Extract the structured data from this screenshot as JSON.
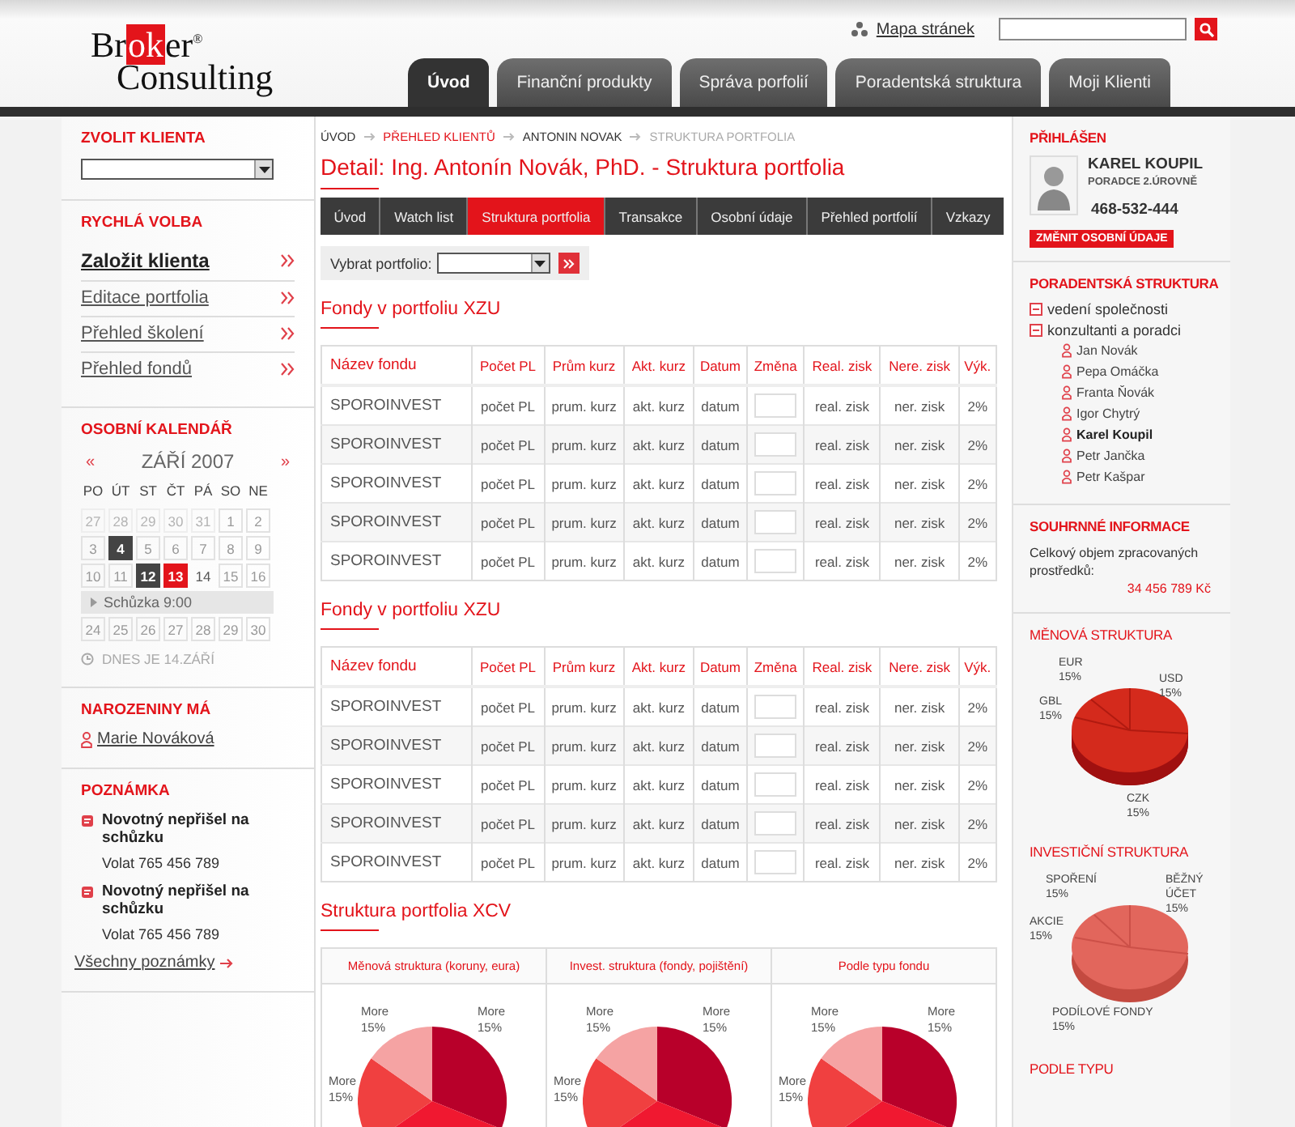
{
  "header": {
    "logo": {
      "parts": [
        "Br",
        "ok",
        "er"
      ],
      "mark": "®",
      "line2": "Consulting"
    },
    "sitemap_link": "Mapa stránek",
    "nav": [
      {
        "label": "Úvod",
        "selected": true
      },
      {
        "label": "Finanční produkty",
        "selected": false
      },
      {
        "label": "Správa porfolií",
        "selected": false
      },
      {
        "label": "Poradentská struktura",
        "selected": false
      },
      {
        "label": "Moji Klienti",
        "selected": false
      }
    ]
  },
  "left": {
    "client": {
      "title": "ZVOLIT KLIENTA"
    },
    "quick": {
      "title": "RYCHLÁ VOLBA",
      "items": [
        {
          "label": "Založit klienta",
          "selected": true
        },
        {
          "label": "Editace portfolia",
          "selected": false
        },
        {
          "label": "Přehled školení",
          "selected": false
        },
        {
          "label": "Přehled fondů",
          "selected": false
        }
      ]
    },
    "calendar": {
      "title": "OSOBNÍ KALENDÁŘ",
      "prev": "«",
      "month": "ZÁŘÍ 2007",
      "next": "»",
      "weekdays": [
        "PO",
        "ÚT",
        "ST",
        "ČT",
        "PÁ",
        "SO",
        "NE"
      ],
      "rows": [
        {
          "kind": "week",
          "days": [
            {
              "day": "27",
              "kind": "other"
            },
            {
              "day": "28",
              "kind": "other"
            },
            {
              "day": "29",
              "kind": "other"
            },
            {
              "day": "30",
              "kind": "other"
            },
            {
              "day": "31",
              "kind": "other"
            },
            {
              "day": "1",
              "kind": "normal"
            },
            {
              "day": "2",
              "kind": "normal"
            }
          ]
        },
        {
          "kind": "week",
          "days": [
            {
              "day": "3",
              "kind": "normal"
            },
            {
              "day": "4",
              "kind": "marked"
            },
            {
              "day": "5",
              "kind": "normal"
            },
            {
              "day": "6",
              "kind": "normal"
            },
            {
              "day": "7",
              "kind": "normal"
            },
            {
              "day": "8",
              "kind": "normal"
            },
            {
              "day": "9",
              "kind": "normal"
            }
          ]
        },
        {
          "kind": "week",
          "days": [
            {
              "day": "10",
              "kind": "normal"
            },
            {
              "day": "11",
              "kind": "normal"
            },
            {
              "day": "12",
              "kind": "marked"
            },
            {
              "day": "13",
              "kind": "today"
            },
            {
              "day": "14",
              "kind": "plain"
            },
            {
              "day": "15",
              "kind": "normal"
            },
            {
              "day": "16",
              "kind": "normal"
            }
          ]
        },
        {
          "kind": "event",
          "text": "Schůzka 9:00"
        },
        {
          "kind": "week",
          "days": [
            {
              "day": "24",
              "kind": "normal"
            },
            {
              "day": "25",
              "kind": "normal"
            },
            {
              "day": "26",
              "kind": "normal"
            },
            {
              "day": "27",
              "kind": "normal"
            },
            {
              "day": "28",
              "kind": "normal"
            },
            {
              "day": "29",
              "kind": "normal"
            },
            {
              "day": "30",
              "kind": "normal"
            }
          ]
        }
      ],
      "today_note": "DNES JE 14.ZÁŘÍ"
    },
    "birthday": {
      "title": "NAROZENINY MÁ",
      "person": "Marie Nováková"
    },
    "notes": {
      "title": "POZNÁMKA",
      "items": [
        {
          "title": "Novotný nepřišel na schůzku",
          "text": "Volat 765 456 789"
        },
        {
          "title": "Novotný nepřišel na schůzku",
          "text": "Volat 765 456 789"
        }
      ],
      "all_link": "Všechny poznámky"
    }
  },
  "main": {
    "breadcrumb": [
      {
        "label": "ÚVOD",
        "kind": "link"
      },
      {
        "label": "PŘEHLED KLIENTŮ",
        "kind": "hover"
      },
      {
        "label": "ANTONIN NOVAK",
        "kind": "link"
      },
      {
        "label": "STRUKTURA PORTFOLIA",
        "kind": "current"
      }
    ],
    "title": "Detail: Ing. Antonín Novák, PhD. - Struktura portfolia",
    "tabs": [
      {
        "label": "Úvod",
        "selected": false
      },
      {
        "label": "Watch list",
        "selected": false
      },
      {
        "label": "Struktura portfolia",
        "selected": true
      },
      {
        "label": "Transakce",
        "selected": false
      },
      {
        "label": "Osobní údaje",
        "selected": false
      },
      {
        "label": "Přehled portfolií",
        "selected": false
      },
      {
        "label": "Vzkazy",
        "selected": false
      }
    ],
    "portfolio_select": {
      "label": "Vybrat portfolio:"
    },
    "tables": [
      {
        "title": "Fondy v portfoliu XZU",
        "columns": [
          "Název fondu",
          "Počet PL",
          "Prům kurz",
          "Akt. kurz",
          "Datum",
          "Změna",
          "Real. zisk",
          "Nere. zisk",
          "Výk."
        ],
        "rows": [
          [
            "SPOROINVEST",
            "počet PL",
            "prum. kurz",
            "akt. kurz",
            "datum",
            "",
            "real. zisk",
            "ner. zisk",
            "2%"
          ],
          [
            "SPOROINVEST",
            "počet PL",
            "prum. kurz",
            "akt. kurz",
            "datum",
            "",
            "real. zisk",
            "ner. zisk",
            "2%"
          ],
          [
            "SPOROINVEST",
            "počet PL",
            "prum. kurz",
            "akt. kurz",
            "datum",
            "",
            "real. zisk",
            "ner. zisk",
            "2%"
          ],
          [
            "SPOROINVEST",
            "počet PL",
            "prum. kurz",
            "akt. kurz",
            "datum",
            "",
            "real. zisk",
            "ner. zisk",
            "2%"
          ],
          [
            "SPOROINVEST",
            "počet PL",
            "prum. kurz",
            "akt. kurz",
            "datum",
            "",
            "real. zisk",
            "ner. zisk",
            "2%"
          ]
        ]
      },
      {
        "title": "Fondy v portfoliu XZU",
        "columns": [
          "Název fondu",
          "Počet PL",
          "Prům kurz",
          "Akt. kurz",
          "Datum",
          "Změna",
          "Real. zisk",
          "Nere. zisk",
          "Výk."
        ],
        "rows": [
          [
            "SPOROINVEST",
            "počet PL",
            "prum. kurz",
            "akt. kurz",
            "datum",
            "",
            "real. zisk",
            "ner. zisk",
            "2%"
          ],
          [
            "SPOROINVEST",
            "počet PL",
            "prum. kurz",
            "akt. kurz",
            "datum",
            "",
            "real. zisk",
            "ner. zisk",
            "2%"
          ],
          [
            "SPOROINVEST",
            "počet PL",
            "prum. kurz",
            "akt. kurz",
            "datum",
            "",
            "real. zisk",
            "ner. zisk",
            "2%"
          ],
          [
            "SPOROINVEST",
            "počet PL",
            "prum. kurz",
            "akt. kurz",
            "datum",
            "",
            "real. zisk",
            "ner. zisk",
            "2%"
          ],
          [
            "SPOROINVEST",
            "počet PL",
            "prum. kurz",
            "akt. kurz",
            "datum",
            "",
            "real. zisk",
            "ner. zisk",
            "2%"
          ]
        ]
      }
    ],
    "structure": {
      "title": "Struktura portfolia XCV",
      "panels": [
        {
          "title": "Měnová struktura (koruny, eura)",
          "labels": [
            {
              "name": "More",
              "value": "15%"
            },
            {
              "name": "More",
              "value": "15%"
            },
            {
              "name": "More",
              "value": "15%"
            }
          ]
        },
        {
          "title": "Invest. struktura (fondy, pojištění)",
          "labels": [
            {
              "name": "More",
              "value": "15%"
            },
            {
              "name": "More",
              "value": "15%"
            },
            {
              "name": "More",
              "value": "15%"
            }
          ]
        },
        {
          "title": "Podle typu fondu",
          "labels": [
            {
              "name": "More",
              "value": "15%"
            },
            {
              "name": "More",
              "value": "15%"
            },
            {
              "name": "More",
              "value": "15%"
            }
          ]
        }
      ]
    }
  },
  "right": {
    "user": {
      "title": "PŘIHLÁŠEN",
      "name": "KAREL KOUPIL",
      "role": "PORADCE 2.ÚROVNĚ",
      "phone": "468-532-444",
      "button": "ZMĚNIT OSOBNÍ ÚDAJE"
    },
    "structure": {
      "title": "PORADENTSKÁ STRUKTURA",
      "tree": [
        {
          "label": "vedení společnosti",
          "expanded": true
        },
        {
          "label": "konzultanti a poradci",
          "expanded": true,
          "children": [
            {
              "label": "Jan Novák",
              "selected": false
            },
            {
              "label": "Pepa Omáčka",
              "selected": false
            },
            {
              "label": "Franta Ňovák",
              "selected": false
            },
            {
              "label": "Igor Chytrý",
              "selected": false
            },
            {
              "label": "Karel Koupil",
              "selected": true
            },
            {
              "label": "Petr Jančka",
              "selected": false
            },
            {
              "label": "Petr Kašpar",
              "selected": false
            }
          ]
        }
      ]
    },
    "summary": {
      "title": "SOUHRNNÉ INFORMACE",
      "label": "Celkový objem zpracovaných prostředků:",
      "value": "34 456 789 Kč"
    },
    "currency": {
      "title": "MĚNOVÁ STRUKTURA",
      "labels": [
        {
          "name": "EUR",
          "value": "15%"
        },
        {
          "name": "USD",
          "value": "15%"
        },
        {
          "name": "GBL",
          "value": "15%"
        },
        {
          "name": "CZK",
          "value": "15%"
        }
      ]
    },
    "investment": {
      "title": "INVESTIČNÍ STRUKTURA",
      "labels": [
        {
          "name": "SPOŘENÍ",
          "value": "15%"
        },
        {
          "name": "BĚŽNÝ ÚČET",
          "value": "15%"
        },
        {
          "name": "AKCIE",
          "value": "15%"
        },
        {
          "name": "PODÍLOVÉ FONDY",
          "value": "15%"
        }
      ]
    },
    "by_type": {
      "title": "PODLE TYPU"
    }
  }
}
